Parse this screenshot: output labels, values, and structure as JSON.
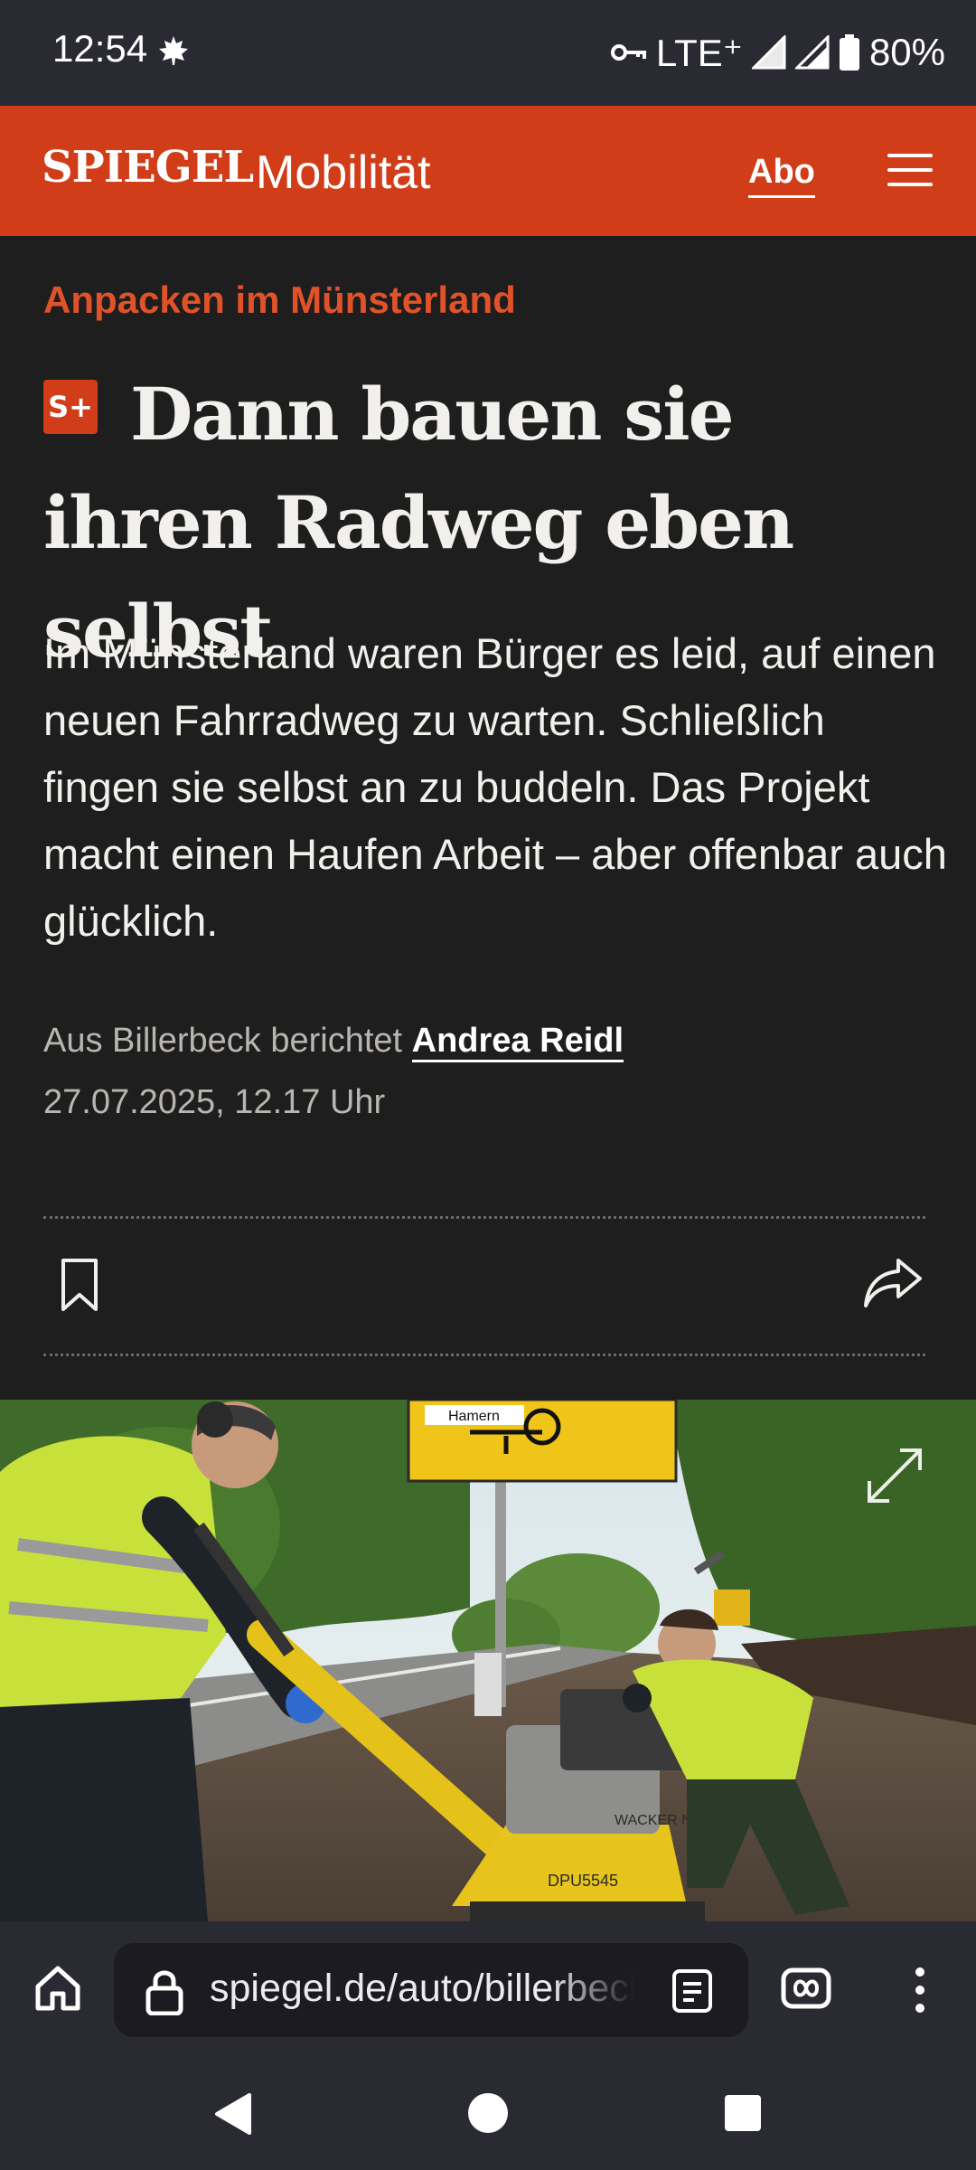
{
  "status_bar": {
    "time": "12:54",
    "network": "LTE⁺",
    "battery": "80%",
    "icons": [
      "leaf-icon",
      "vpn-key-icon",
      "signal-icon",
      "signal-icon",
      "battery-icon"
    ]
  },
  "header": {
    "logo": "SPIEGEL",
    "section": "Mobilität",
    "abo_label": "Abo",
    "brand_color": "#d03d18"
  },
  "article": {
    "kicker": "Anpacken im Münsterland",
    "plus_badge": "S+",
    "headline": "Dann bauen sie ihren Radweg eben selbst",
    "teaser": "Im Münsterland waren Bürger es leid, auf einen neuen Fahrradweg zu warten. Schließlich fingen sie selbst an zu buddeln. Das Projekt macht einen Haufen Arbeit – aber offenbar auch glücklich.",
    "byline_prefix": "Aus Billerbeck berichtet",
    "author": "Andrea Reidl",
    "date": "27.07.2025, 12.17 Uhr"
  },
  "photo": {
    "sign_text": "Hamern",
    "machine_label": "DPU5545",
    "brand_label": "WACKER NEUSON"
  },
  "browser": {
    "url": "spiegel.de/auto/billerbeck"
  }
}
